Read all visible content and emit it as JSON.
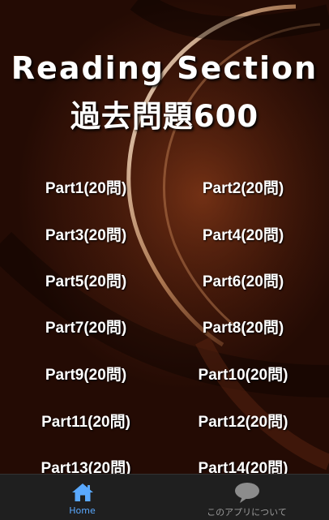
{
  "header": {
    "title_line1": "Reading Section",
    "title_line2": "過去問題600"
  },
  "parts": [
    "Part1(20問)",
    "Part2(20問)",
    "Part3(20問)",
    "Part4(20問)",
    "Part5(20問)",
    "Part6(20問)",
    "Part7(20問)",
    "Part8(20問)",
    "Part9(20問)",
    "Part10(20問)",
    "Part11(20問)",
    "Part12(20問)",
    "Part13(20問)",
    "Part14(20問)"
  ],
  "bottom_nav": {
    "home_label": "Home",
    "about_label": "このアプリについて",
    "home_icon": "home-icon",
    "about_icon": "speech-bubble-icon",
    "active_color": "#5aa9ff",
    "inactive_color": "#9a9a9a"
  }
}
